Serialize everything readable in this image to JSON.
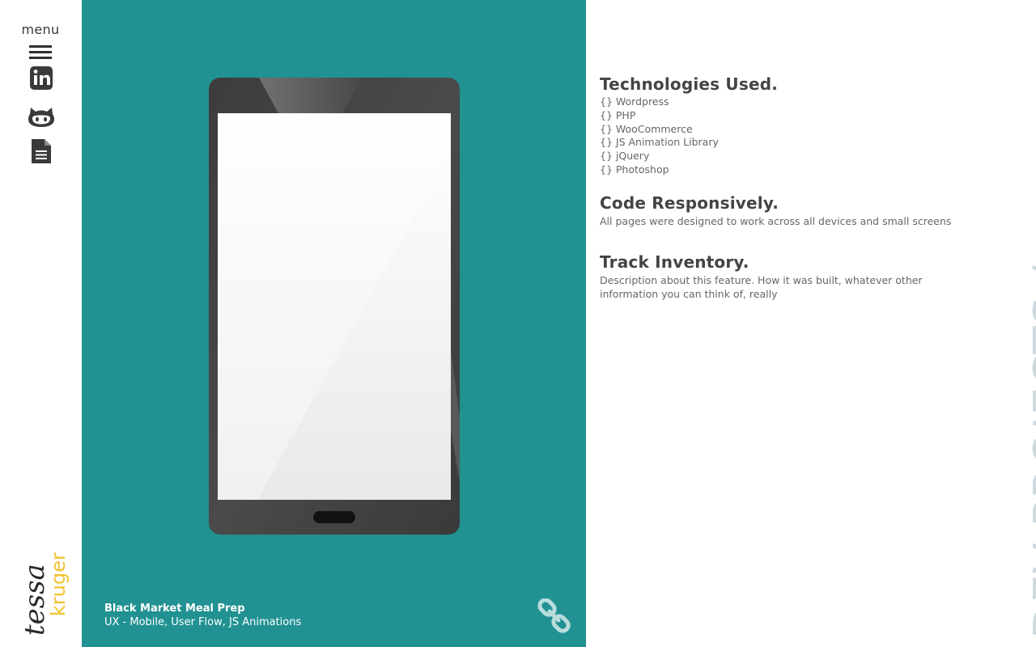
{
  "sidebar": {
    "menu_label": "menu",
    "icons": [
      "hamburger-icon",
      "linkedin-icon",
      "github-icon",
      "document-icon"
    ],
    "logo": {
      "first": "tessa",
      "last": "kruger"
    }
  },
  "panel": {
    "background": "#219192",
    "project_title": "Black Market Meal Prep",
    "project_subtitle": "UX - Mobile, User Flow, JS Animations",
    "link_icon": "link-icon"
  },
  "details": {
    "technologies": {
      "heading": "Technologies Used.",
      "items": [
        "{} Wordpress",
        "{} PHP",
        "{} WooCommerce",
        "{} JS Animation Library",
        "{} jQuery",
        "{} Photoshop"
      ]
    },
    "responsive": {
      "heading": "Code Responsively.",
      "text": "All pages were designed to work across all devices and small screens"
    },
    "inventory": {
      "heading": "Track Inventory.",
      "text": "Description about this feature. How it was built, whatever other information you can think of, really"
    }
  },
  "page_title": "DEV PROJECTS /"
}
